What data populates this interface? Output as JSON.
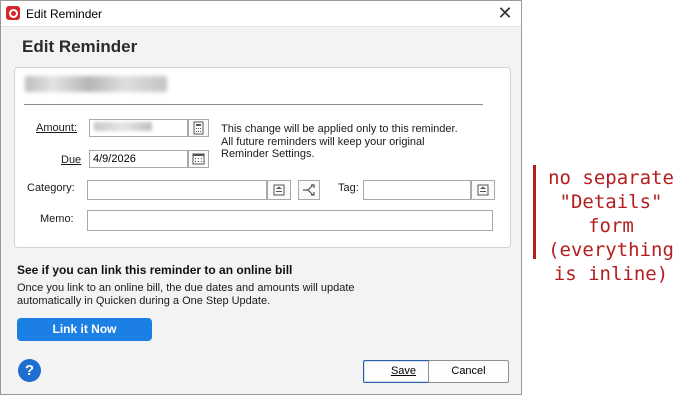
{
  "window": {
    "title": "Edit Reminder",
    "close_glyph": "✕"
  },
  "heading": "Edit Reminder",
  "form": {
    "amount_label": "Amount:",
    "due_label": "Due",
    "due_value": "4/9/2026",
    "category_label": "Category:",
    "tag_label": "Tag:",
    "memo_label": "Memo:",
    "note_lines": [
      "This change will be applied only to this reminder.",
      "All future reminders will keep your original",
      "Reminder Settings."
    ]
  },
  "link": {
    "heading": "See if you can link this reminder to an online bill",
    "desc_lines": [
      "Once you link to an online bill, the due dates and amounts will update",
      "automatically in Quicken during a One Step Update."
    ],
    "button_label": "Link it Now"
  },
  "footer": {
    "help_glyph": "?",
    "save_label": "Save",
    "cancel_label": "Cancel"
  },
  "annotation": {
    "lines": [
      "no separate",
      "\"Details\"",
      "form",
      "(everything",
      "is inline)"
    ],
    "color": "#b41e1e"
  },
  "colors": {
    "accent": "#1b7fe3",
    "brand": "#d6262c"
  }
}
